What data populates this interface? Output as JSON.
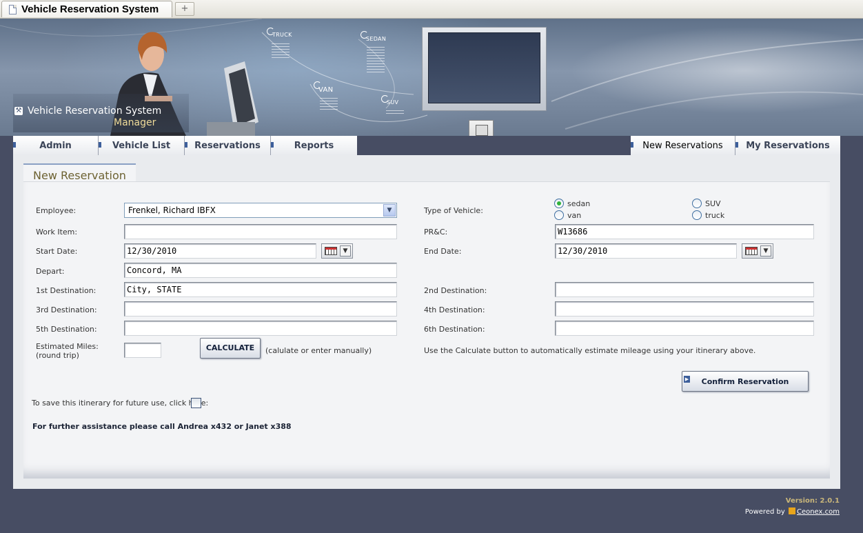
{
  "browser": {
    "tab_title": "Vehicle Reservation System",
    "new_tab_glyph": "+"
  },
  "header": {
    "brand_title": "Vehicle Reservation System",
    "brand_subtitle": "Manager",
    "vehicle_labels": [
      "TRUCK",
      "SEDAN",
      "VAN",
      "SUV"
    ]
  },
  "nav": {
    "left": [
      "Admin",
      "Vehicle List",
      "Reservations",
      "Reports"
    ],
    "right": [
      "New Reservations",
      "My Reservations"
    ]
  },
  "form": {
    "tab_title": "New Reservation",
    "employee": {
      "label": "Employee:",
      "value": "Frenkel, Richard IBFX"
    },
    "work_item": {
      "label": "Work Item:",
      "value": ""
    },
    "start_date": {
      "label": "Start Date:",
      "value": "12/30/2010"
    },
    "depart": {
      "label": "Depart:",
      "value": "Concord, MA"
    },
    "dest1": {
      "label": "1st Destination:",
      "value": "City, STATE"
    },
    "dest3": {
      "label": "3rd Destination:",
      "value": ""
    },
    "dest5": {
      "label": "5th Destination:",
      "value": ""
    },
    "miles": {
      "label_line1": "Estimated Miles:",
      "label_line2": "(round trip)",
      "value": ""
    },
    "calculate_label": "CALCULATE",
    "calculate_hint": "(calulate or enter manually)",
    "vehicle_type": {
      "label": "Type of Vehicle:",
      "options": [
        "sedan",
        "SUV",
        "van",
        "truck"
      ],
      "selected": "sedan"
    },
    "prc": {
      "label": "PR&C:",
      "value": "W13686"
    },
    "end_date": {
      "label": "End Date:",
      "value": "12/30/2010"
    },
    "dest2": {
      "label": "2nd Destination:",
      "value": ""
    },
    "dest4": {
      "label": "4th Destination:",
      "value": ""
    },
    "dest6": {
      "label": "6th Destination:",
      "value": ""
    },
    "calc_instructions": "Use the Calculate button to automatically estimate mileage using your itinerary above.",
    "confirm_label": "Confirm Reservation",
    "save_itinerary": "To save this itinerary for future use, click here:",
    "assistance": "For further assistance please call Andrea x432 or Janet x388"
  },
  "footer": {
    "version": "Version: 2.0.1",
    "powered_by": "Powered by",
    "powered_link": "Ceonex.com"
  },
  "colors": {
    "page_bg": "#474d63",
    "nav_text": "#3b4458",
    "form_title": "#6d6232",
    "radio_selected": "#2fb23a",
    "accent": "#3d5f9b",
    "brand_subtitle": "#f0dc9a"
  }
}
